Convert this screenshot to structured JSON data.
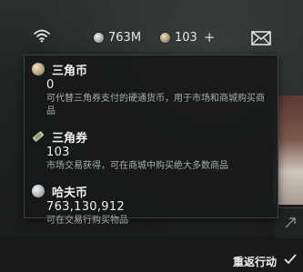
{
  "topbar": {
    "silver_amount": "763M",
    "gold_amount": "103",
    "plus": "+"
  },
  "tooltip": {
    "entries": [
      {
        "icon": "gold-coin-icon",
        "title": "三角币",
        "value": "0",
        "desc": "可代替三角券支付的硬通货币，用于市场和商城购买商品"
      },
      {
        "icon": "ticket-icon",
        "title": "三角券",
        "value": "103",
        "desc": "市场交易获得，可在商城中购买绝大多数商品"
      },
      {
        "icon": "silver-coin-icon",
        "title": "哈夫币",
        "value": "763,130,912",
        "desc": "可在交易行购买物品"
      }
    ]
  },
  "footer": {
    "return_label": "重返行动"
  }
}
